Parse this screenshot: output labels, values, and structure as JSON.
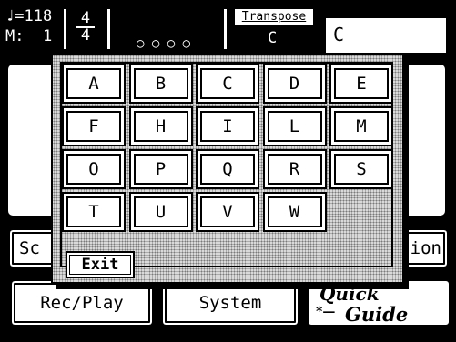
{
  "status": {
    "tempo_symbol": "♩",
    "tempo_value": "=118",
    "measure_label": "M:",
    "measure_value": "1",
    "time_sig_top": "4",
    "time_sig_bottom": "4",
    "beats": "○ ○ ○ ○",
    "transpose_label": "Transpose",
    "transpose_value": "C",
    "key_display": "C"
  },
  "background_buttons": {
    "left_mid": "Sc",
    "right_mid": "ion",
    "rec_play": "Rec/Play",
    "system": "System",
    "quick_guide_line1": "Quick",
    "quick_guide_line2": "Guide"
  },
  "dialog": {
    "keys": [
      [
        "A",
        "B",
        "C",
        "D",
        "E"
      ],
      [
        "F",
        "H",
        "I",
        "L",
        "M"
      ],
      [
        "O",
        "P",
        "Q",
        "R",
        "S"
      ],
      [
        "T",
        "U",
        "V",
        "W"
      ]
    ],
    "exit_label": "Exit"
  }
}
